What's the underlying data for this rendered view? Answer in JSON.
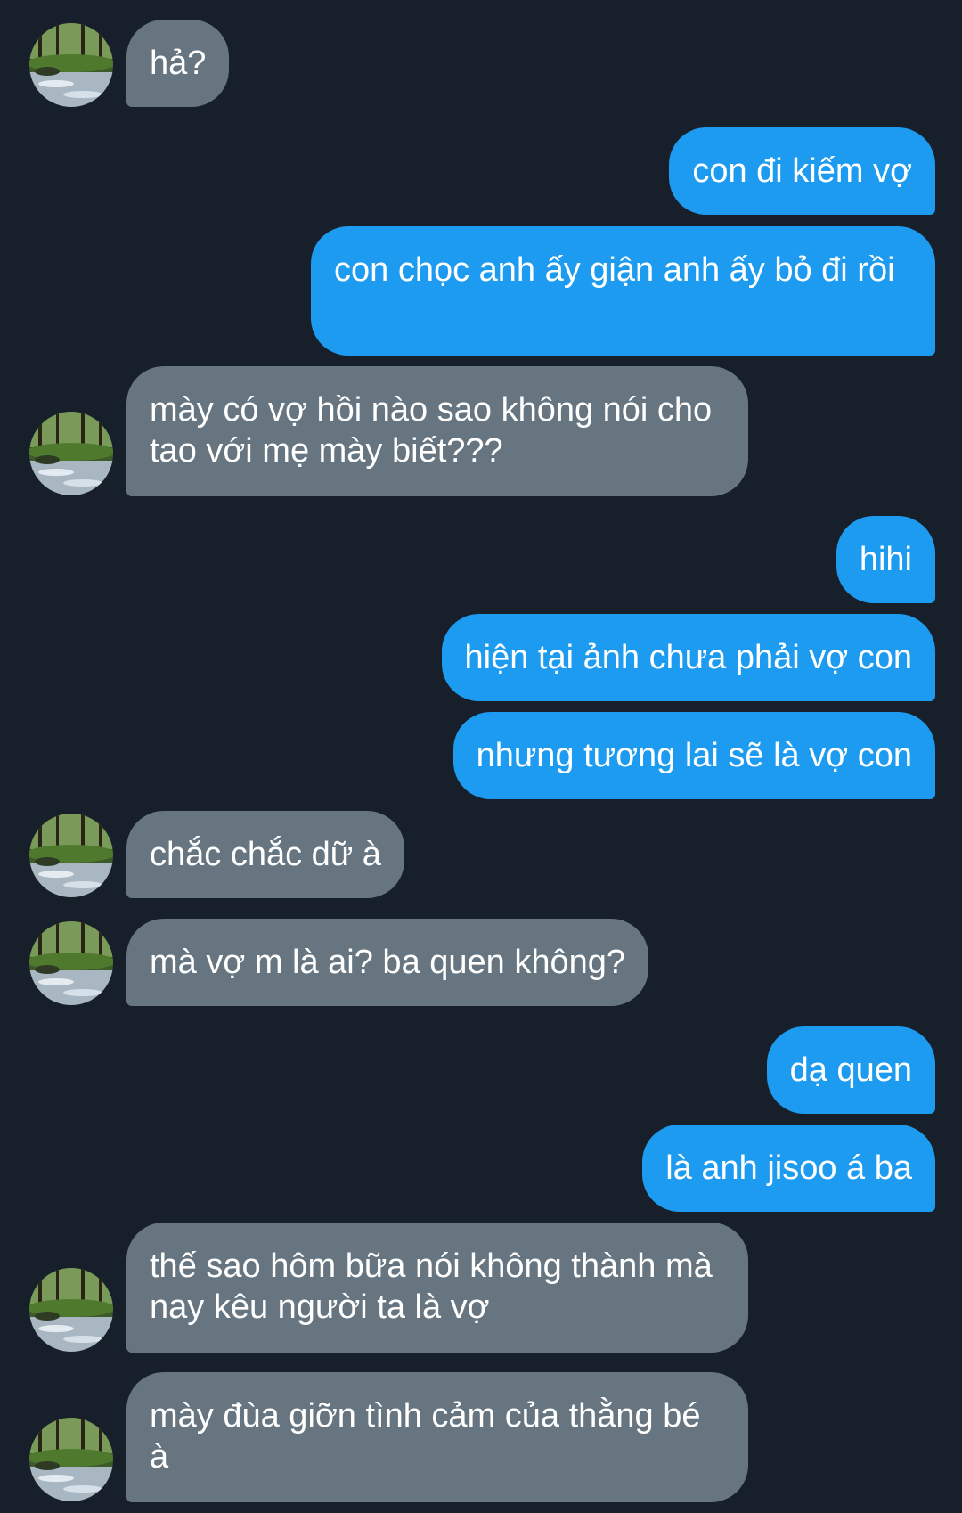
{
  "colors": {
    "background": "#17202a",
    "incoming_bubble": "#66757f",
    "outgoing_bubble": "#1d9bf0",
    "text": "#ffffff"
  },
  "contact": {
    "avatar_icon": "forest-stream-avatar-icon"
  },
  "messages": [
    {
      "sender": "them",
      "text": "hả?"
    },
    {
      "sender": "me",
      "text": "con đi kiếm vợ"
    },
    {
      "sender": "me",
      "text": "con chọc anh ấy giận anh ấy bỏ đi rồi"
    },
    {
      "sender": "them",
      "text": "mày có vợ hồi nào sao không nói cho tao với mẹ mày biết???"
    },
    {
      "sender": "me",
      "text": "hihi"
    },
    {
      "sender": "me",
      "text": "hiện tại ảnh chưa phải vợ con"
    },
    {
      "sender": "me",
      "text": "nhưng tương lai sẽ là vợ con"
    },
    {
      "sender": "them",
      "text": "chắc chắc dữ à"
    },
    {
      "sender": "them",
      "text": "mà vợ m là ai? ba quen không?"
    },
    {
      "sender": "me",
      "text": "dạ quen"
    },
    {
      "sender": "me",
      "text": "là anh jisoo á ba"
    },
    {
      "sender": "them",
      "text": "thế sao hôm bữa nói không thành mà nay kêu người ta là vợ"
    },
    {
      "sender": "them",
      "text": "mày đùa giỡn tình cảm của thằng bé à"
    }
  ]
}
